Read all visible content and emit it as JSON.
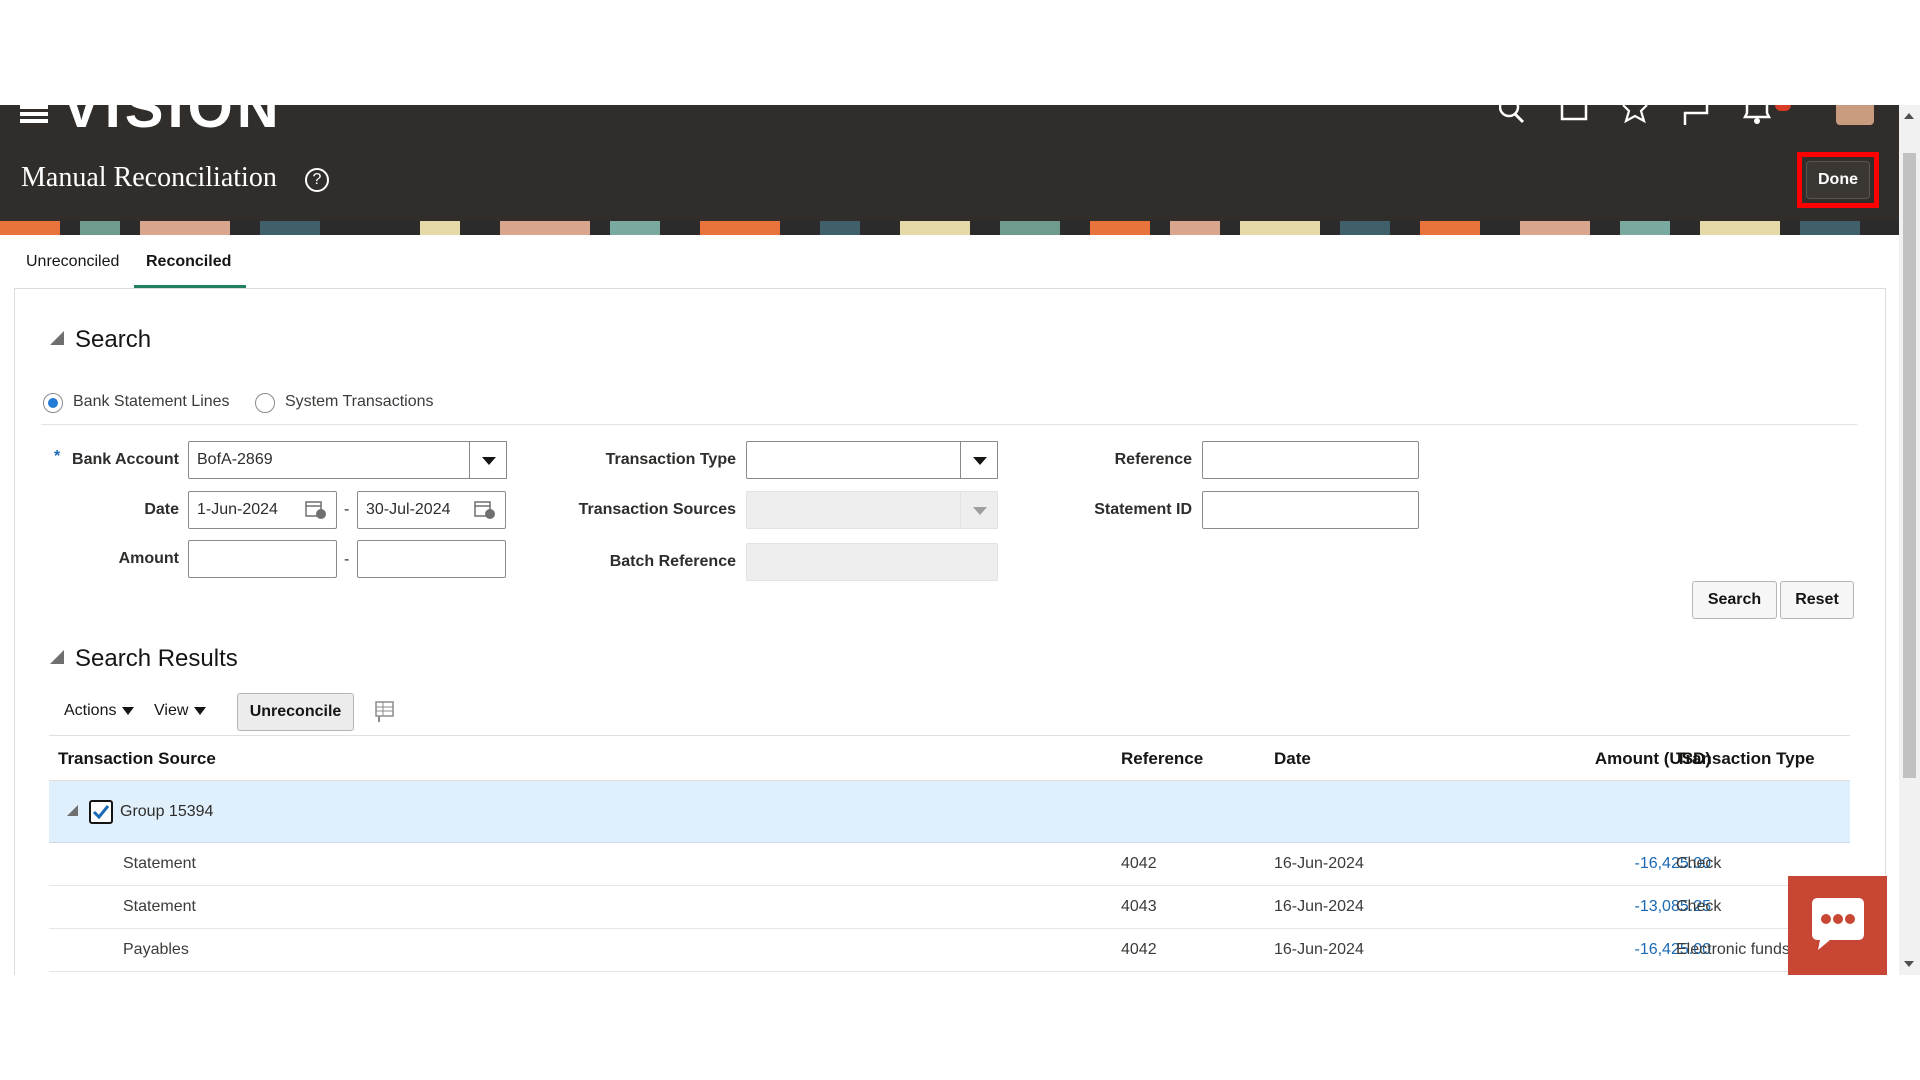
{
  "header": {
    "logo_text": "VISION",
    "page_title": "Manual Reconciliation",
    "help_symbol": "?",
    "done_label": "Done",
    "icons": [
      "search-icon",
      "home-icon",
      "favorites-star-icon",
      "flag-icon",
      "notifications-bell-icon"
    ]
  },
  "tabs": [
    {
      "label": "Unreconciled",
      "active": false
    },
    {
      "label": "Reconciled",
      "active": true
    }
  ],
  "search": {
    "title": "Search",
    "radio_options": [
      {
        "label": "Bank Statement Lines",
        "selected": true
      },
      {
        "label": "System Transactions",
        "selected": false
      }
    ],
    "fields": {
      "bank_account": {
        "label": "Bank Account",
        "value": "BofA-2869",
        "required": "*"
      },
      "date": {
        "label": "Date",
        "from": "1-Jun-2024",
        "to": "30-Jul-2024",
        "separator": "-"
      },
      "amount": {
        "label": "Amount",
        "from": "",
        "to": "",
        "separator": "-"
      },
      "transaction_type": {
        "label": "Transaction Type",
        "value": ""
      },
      "transaction_sources": {
        "label": "Transaction Sources",
        "value": ""
      },
      "batch_reference": {
        "label": "Batch Reference",
        "value": ""
      },
      "reference": {
        "label": "Reference",
        "value": ""
      },
      "statement_id": {
        "label": "Statement ID",
        "value": ""
      }
    },
    "search_button": "Search",
    "reset_button": "Reset"
  },
  "results": {
    "title": "Search Results",
    "toolbar": {
      "actions": "Actions",
      "view": "View",
      "unreconcile": "Unreconcile"
    },
    "columns": [
      "Transaction Source",
      "Reference",
      "Date",
      "Amount (USD)",
      "Transaction Type"
    ],
    "group": {
      "label": "Group 15394",
      "checked": true
    },
    "rows": [
      {
        "source": "Statement",
        "reference": "4042",
        "date": "16-Jun-2024",
        "amount": "-16,425.00",
        "type": "Check"
      },
      {
        "source": "Statement",
        "reference": "4043",
        "date": "16-Jun-2024",
        "amount": "-13,085.25",
        "type": "Check"
      },
      {
        "source": "Payables",
        "reference": "4042",
        "date": "16-Jun-2024",
        "amount": "-16,425.00",
        "type": "Electronic funds"
      }
    ]
  },
  "colors": {
    "header_bg": "#312d2a",
    "accent_tab": "#227e5f",
    "highlight_border": "#ff0000",
    "link_amount": "#1a6ab5",
    "selected_row": "#dfeffc",
    "chat_widget": "#c74634"
  }
}
